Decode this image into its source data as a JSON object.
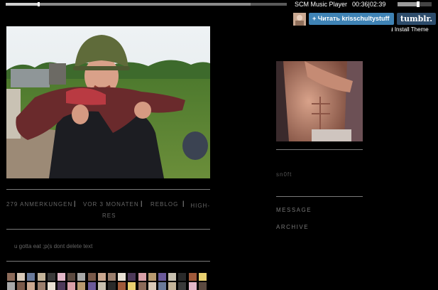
{
  "player": {
    "title": "SCM Music Player",
    "time": "00:36|02:39",
    "progress": 0.115,
    "buffered": 0.87,
    "volume": 0.6
  },
  "tumblr": {
    "follow_label": "+ Читать krisschultystuff",
    "logo_label": "tumblr.",
    "install_label": "Install Theme",
    "accent": "#3f83b5",
    "logo_bg": "#2d4c6b",
    "avatar_icon": "avatar-image",
    "install_icon": "download-icon"
  },
  "post": {
    "meta": {
      "notes": "279 ANMERKUNGEN",
      "time": "VOR 3 MONATEN",
      "reblog": "REBLOG",
      "high_res": "HIGH-RES",
      "separator": "|"
    },
    "caption": "u gotta eat ;p(s dont delete text"
  },
  "sidebar": {
    "text": "sn0ft",
    "links": [
      "MESSAGE",
      "ARCHIVE"
    ]
  }
}
